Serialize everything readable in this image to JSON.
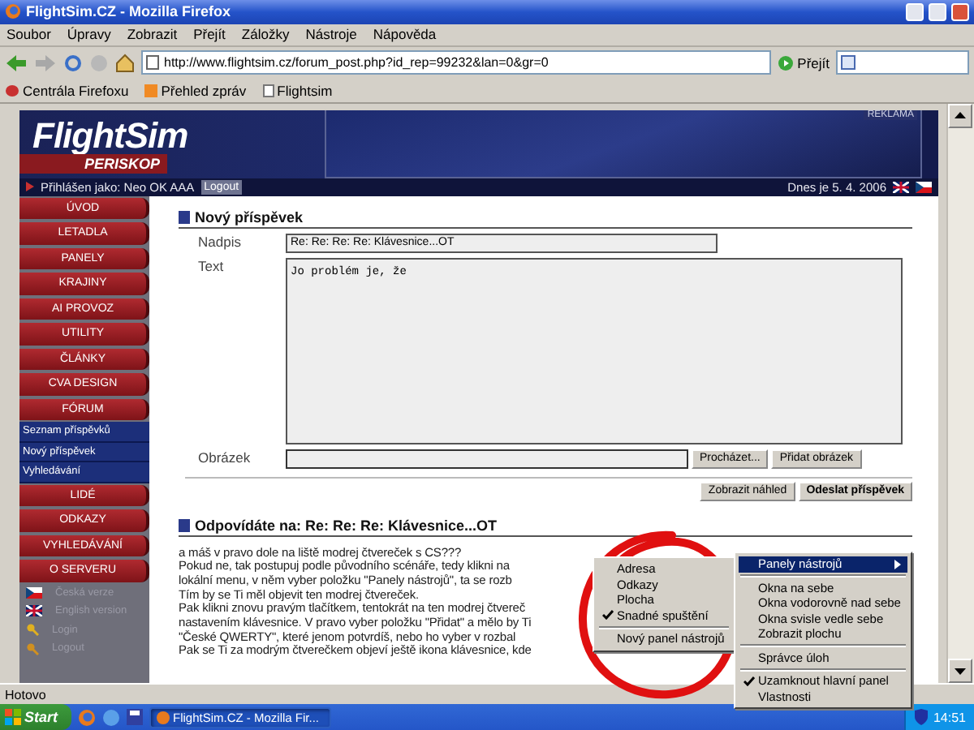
{
  "window": {
    "title": "FlightSim.CZ - Mozilla Firefox"
  },
  "menu_bar": [
    "Soubor",
    "Úpravy",
    "Zobrazit",
    "Přejít",
    "Záložky",
    "Nástroje",
    "Nápověda"
  ],
  "address_bar": {
    "url": "http://www.flightsim.cz/forum_post.php?id_rep=99232&lan=0&gr=0",
    "go_label": "Přejít"
  },
  "bookmarks": [
    "Centrála Firefoxu",
    "Přehled zpráv",
    "Flightsim"
  ],
  "site_header": {
    "logo": "FlightSim",
    "logo_subtitle": "PERISKOP",
    "ad_label": "REKLAMA",
    "login_text": "Přihlášen jako: Neo OK AAA",
    "logout_button": "Logout",
    "date": "Dnes je 5. 4. 2006"
  },
  "sidebar": {
    "items": [
      {
        "label": "ÚVOD",
        "kind": "section"
      },
      {
        "label": "LETADLA",
        "kind": "section"
      },
      {
        "label": "PANELY",
        "kind": "section"
      },
      {
        "label": "KRAJINY",
        "kind": "section"
      },
      {
        "label": "AI PROVOZ",
        "kind": "section"
      },
      {
        "label": "UTILITY",
        "kind": "section"
      },
      {
        "label": "ČLÁNKY",
        "kind": "section"
      },
      {
        "label": "CVA DESIGN",
        "kind": "section"
      },
      {
        "label": "FÓRUM",
        "kind": "section"
      },
      {
        "label": "Seznam příspěvků",
        "kind": "sub"
      },
      {
        "label": "Nový příspěvek",
        "kind": "sub"
      },
      {
        "label": "Vyhledávání",
        "kind": "sub"
      },
      {
        "label": "LIDÉ",
        "kind": "section"
      },
      {
        "label": "ODKAZY",
        "kind": "section"
      },
      {
        "label": "VYHLEDÁVÁNÍ",
        "kind": "section"
      },
      {
        "label": "O SERVERU",
        "kind": "section"
      },
      {
        "label": "Česká verze",
        "kind": "extra"
      },
      {
        "label": "English version",
        "kind": "extra"
      },
      {
        "label": "Login",
        "kind": "extra"
      },
      {
        "label": "Logout",
        "kind": "extra"
      }
    ]
  },
  "new_post": {
    "heading": "Nový příspěvek",
    "title_label": "Nadpis",
    "title_value": "Re: Re: Re: Re: Klávesnice...OT",
    "text_label": "Text",
    "text_value": "Jo problém je, že",
    "image_label": "Obrázek",
    "browse_button": "Procházet...",
    "add_image_button": "Přidat obrázek",
    "preview_button": "Zobrazit náhled",
    "submit_button": "Odeslat příspěvek"
  },
  "reply": {
    "heading": "Odpovídáte na: Re: Re: Re: Klávesnice...OT",
    "lines": [
      "a máš v pravo dole na liště modrej čtvereček s CS???",
      "Pokud ne, tak postupuj podle původního scénáře, tedy klikni na",
      "lokální menu, v něm vyber položku \"Panely nástrojů\", ta se rozb",
      "Tím by se Ti měl objevit ten modrej čtvereček.",
      "Pak klikni znovu pravým tlačítkem, tentokrát na ten modrej čtvereč",
      "nastavením klávesnice. V pravo vyber položku \"Přidat\" a mělo by Ti",
      "\"České QWERTY\", které jenom potvrdíš, nebo ho vyber v rozbal",
      "Pak se Ti za modrým čtverečkem objeví ještě ikona klávesnice, kde"
    ]
  },
  "status_bar": {
    "text": "Hotovo"
  },
  "taskbar": {
    "start": "Start",
    "tasks": [
      {
        "label": "FlightSim.CZ - Mozilla Fir...",
        "selected": true
      }
    ],
    "clock": "14:51"
  },
  "submenu": {
    "items": [
      {
        "kind": "item",
        "label": "Adresa",
        "checked": false,
        "selected": false
      },
      {
        "kind": "item",
        "label": "Odkazy",
        "checked": false,
        "selected": false
      },
      {
        "kind": "item",
        "label": "Plocha",
        "checked": false,
        "selected": false
      },
      {
        "kind": "item",
        "label": "Snadné spuštění",
        "checked": true,
        "selected": false
      },
      {
        "kind": "separator"
      },
      {
        "kind": "item",
        "label": "Nový panel nástrojů",
        "checked": false,
        "selected": false
      }
    ]
  },
  "context_menu": {
    "items": [
      {
        "kind": "item",
        "label": "Panely nástrojů",
        "checked": false,
        "selected": true,
        "submenu": true
      },
      {
        "kind": "separator"
      },
      {
        "kind": "item",
        "label": "Okna na sebe",
        "checked": false,
        "selected": false,
        "submenu": false
      },
      {
        "kind": "item",
        "label": "Okna vodorovně nad sebe",
        "checked": false,
        "selected": false,
        "submenu": false
      },
      {
        "kind": "item",
        "label": "Okna svisle vedle sebe",
        "checked": false,
        "selected": false,
        "submenu": false
      },
      {
        "kind": "item",
        "label": "Zobrazit plochu",
        "checked": false,
        "selected": false,
        "submenu": false
      },
      {
        "kind": "separator"
      },
      {
        "kind": "item",
        "label": "Správce úloh",
        "checked": false,
        "selected": false,
        "submenu": false
      },
      {
        "kind": "separator"
      },
      {
        "kind": "item",
        "label": "Uzamknout hlavní panel",
        "checked": true,
        "selected": false,
        "submenu": false
      },
      {
        "kind": "item",
        "label": "Vlastnosti",
        "checked": false,
        "selected": false,
        "submenu": false
      }
    ]
  }
}
